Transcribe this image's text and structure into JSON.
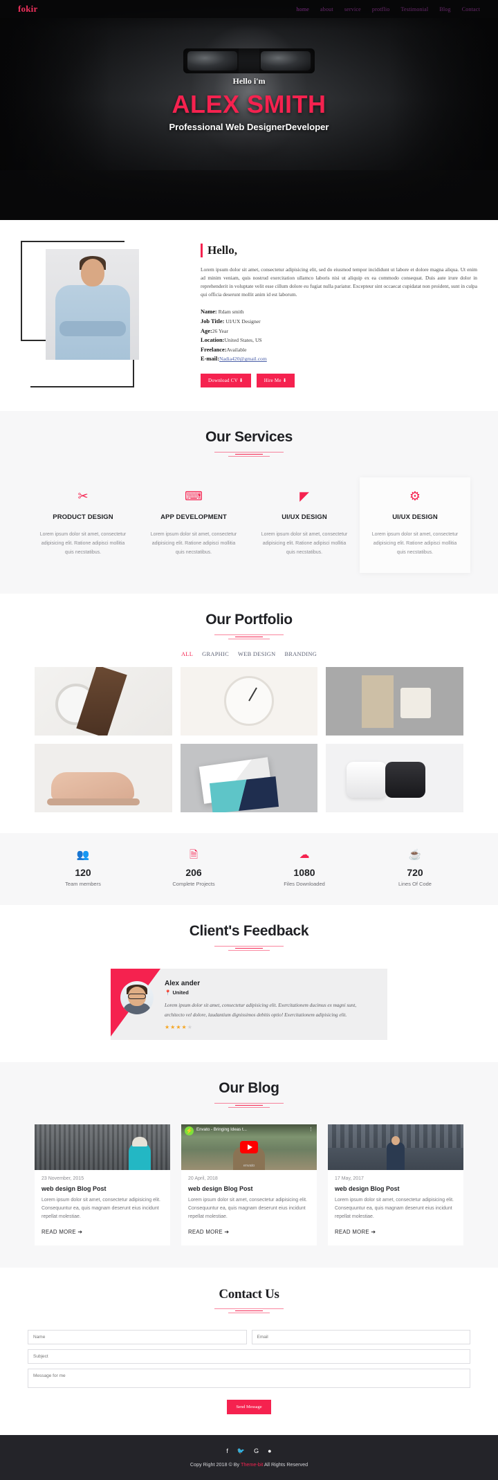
{
  "nav": {
    "brand": "fokir",
    "links": [
      {
        "label": "home",
        "active": true
      },
      {
        "label": "about",
        "active": false
      },
      {
        "label": "service",
        "active": false
      },
      {
        "label": "protflio",
        "active": false
      },
      {
        "label": "Testimonial",
        "active": false
      },
      {
        "label": "Blog",
        "active": false
      },
      {
        "label": "Contact",
        "active": false
      }
    ]
  },
  "hero": {
    "greeting": "Hello i'm",
    "name": "ALEX SMITH",
    "role": "Professional Web DesignerDeveloper",
    "accent_color": "#f5224f"
  },
  "about": {
    "heading": "Hello,",
    "paragraph": "Lorem ipsum dolor sit amet, consectetur adipisicing elit, sed do eiusmod tempor incididunt ut labore et dolore magna aliqua. Ut enim ad minim veniam, quis nostrud exercitation ullamco laboris nisi ut aliquip ex ea commodo consequat. Duis aute irure dolor in reprehenderit in voluptate velit esse cillum dolore eu fugiat nulla pariatur. Excepteur sint occaecat cupidatat non proident, sunt in culpa qui officia deserunt mollit anim id est laborum.",
    "details": [
      {
        "label": "Name:",
        "value": "Rdam smith"
      },
      {
        "label": "Job Title:",
        "value": "UI/UX Designer"
      },
      {
        "label": "Age:",
        "value": "26 Year"
      },
      {
        "label": "Location:",
        "value": "United States, US"
      },
      {
        "label": "Freelance:",
        "value": "Available"
      },
      {
        "label": "E-mail:",
        "value": "Nadia420@gmail.com",
        "is_link": true
      }
    ],
    "buttons": [
      {
        "label": "Download CV ⬇"
      },
      {
        "label": "Hire Me ⬇"
      }
    ]
  },
  "services": {
    "title": "Our Services",
    "cards": [
      {
        "icon": "tools-icon",
        "glyph": "✂",
        "title": "PRODUCT DESIGN",
        "desc": "Lorem ipsum dolor sit amet, consectetur adipisicing elit. Ratione adipisci mollitia quis necstatibus.",
        "active": false
      },
      {
        "icon": "laptop-code-icon",
        "glyph": "⌨",
        "title": "APP DEVELOPMENT",
        "desc": "Lorem ipsum dolor sit amet, consectetur adipisicing elit. Ratione adipisci mollitia quis necstatibus.",
        "active": false
      },
      {
        "icon": "chart-line-icon",
        "glyph": "◤",
        "title": "UI/UX DESIGN",
        "desc": "Lorem ipsum dolor sit amet, consectetur adipisicing elit. Ratione adipisci mollitia quis necstatibus.",
        "active": false
      },
      {
        "icon": "cogs-icon",
        "glyph": "⚙",
        "title": "UI/UX DESIGN",
        "desc": "Lorem ipsum dolor sit amet, consectetur adipisicing elit. Ratione adipisci mollitia quis necstatibus.",
        "active": true
      }
    ]
  },
  "portfolio": {
    "title": "Our Portfolio",
    "filters": [
      {
        "label": "ALL",
        "active": true
      },
      {
        "label": "GRAPHIC",
        "active": false
      },
      {
        "label": "WEB DESIGN",
        "active": false
      },
      {
        "label": "BRANDING",
        "active": false
      }
    ],
    "items": [
      {
        "name": "wrist-watch"
      },
      {
        "name": "wall-clock"
      },
      {
        "name": "packaging-boxes"
      },
      {
        "name": "sneaker"
      },
      {
        "name": "business-cards"
      },
      {
        "name": "device-pair"
      }
    ]
  },
  "counters": [
    {
      "icon": "users-icon",
      "glyph": "👥",
      "number": "120",
      "label": "Team members"
    },
    {
      "icon": "file-icon",
      "glyph": "🗎",
      "number": "206",
      "label": "Complete Projects"
    },
    {
      "icon": "cloud-download-icon",
      "glyph": "☁",
      "number": "1080",
      "label": "Files Downloaded"
    },
    {
      "icon": "coffee-icon",
      "glyph": "☕",
      "number": "720",
      "label": "Lines Of Code"
    }
  ],
  "testimonial": {
    "title": "Client's Feedback",
    "name": "Alex ander",
    "location": "United",
    "location_icon": "📍",
    "quote": "Lorem ipsum dolor sit amet, consectetur adipisicing elit. Exercitationem ducimus ex magni sunt, architecto vel dolore, laudantium dignissimos debitis optio! Exercitationem adipisicing elit.",
    "rating": 4,
    "rating_max": 5
  },
  "blog": {
    "title": "Our Blog",
    "posts": [
      {
        "date": "23 November, 2015",
        "title": "web design Blog Post",
        "desc": "Lorem ipsum dolor sit amet, consectetur adipisicing elit. Consequuntur ea, quis magnam deserunt eius incidunt repellat molestiae.",
        "more": "READ MORE ➔",
        "media": "photo"
      },
      {
        "date": "20 April, 2018",
        "title": "web design Blog Post",
        "desc": "Lorem ipsum dolor sit amet, consectetur adipisicing elit. Consequuntur ea, quis magnam deserunt eius incidunt repellat molestiae.",
        "more": "READ MORE ➔",
        "media": "video",
        "video_title": "Envato - Bringing Ideas t...",
        "video_watermark": "envato"
      },
      {
        "date": "17 May, 2017",
        "title": "web design Blog Post",
        "desc": "Lorem ipsum dolor sit amet, consectetur adipisicing elit. Consequuntur ea, quis magnam deserunt eius incidunt repellat molestiae.",
        "more": "READ MORE ➔",
        "media": "photo"
      }
    ]
  },
  "contact": {
    "title": "Contact Us",
    "fields": {
      "name_placeholder": "Name",
      "email_placeholder": "Email",
      "subject_placeholder": "Subject",
      "message_placeholder": "Message for me"
    },
    "send_label": "Send Message"
  },
  "footer": {
    "social": [
      {
        "name": "facebook-icon",
        "glyph": "f"
      },
      {
        "name": "twitter-icon",
        "glyph": "🐦"
      },
      {
        "name": "google-plus-icon",
        "glyph": "G"
      },
      {
        "name": "github-icon",
        "glyph": "●"
      }
    ],
    "copy_prefix": "Copy Right 2018 © By ",
    "copy_link": "Theme-bit",
    "copy_suffix": " All Rights Reserved"
  }
}
